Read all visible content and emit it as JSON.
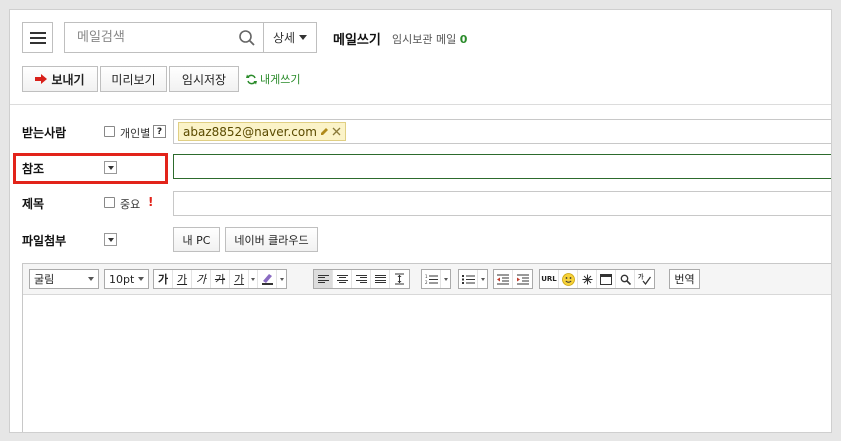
{
  "header": {
    "search_placeholder": "메일검색",
    "detail_label": "상세",
    "title": "메일쓰기",
    "drafts_label": "임시보관 메일",
    "drafts_count": "0"
  },
  "actions": {
    "send_label": "보내기",
    "preview_label": "미리보기",
    "save_draft_label": "임시저장",
    "write_to_self_label": "내게쓰기"
  },
  "form": {
    "to_label": "받는사람",
    "individual_label": "개인별",
    "help_glyph": "?",
    "recipient_email": "abaz8852@naver.com",
    "cc_label": "참조",
    "cc_value": "",
    "subject_label": "제목",
    "important_label": "중요",
    "important_mark": "!",
    "subject_value": "",
    "attach_label": "파일첨부",
    "my_pc_label": "내 PC",
    "cloud_label": "네이버 클라우드"
  },
  "editor_toolbar": {
    "font_family": "굴림",
    "font_size": "10pt",
    "bold": "가",
    "underline": "가",
    "italic": "가",
    "strike": "가",
    "font_color": "가",
    "url": "URL",
    "translate_label": "번역"
  },
  "colors": {
    "accent_green": "#2a8b2a",
    "highlight_red": "#e2231a",
    "send_arrow_red": "#d8201a"
  }
}
